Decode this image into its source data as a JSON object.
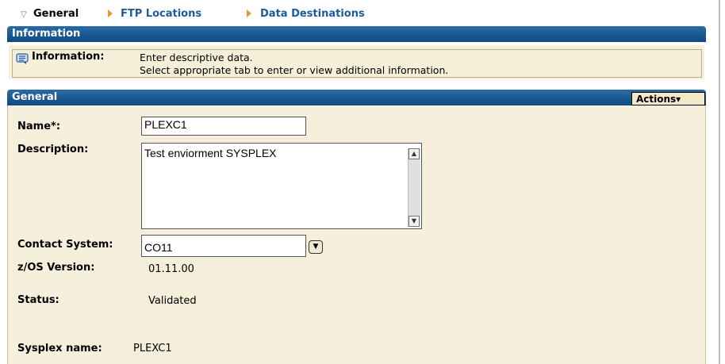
{
  "tabs": {
    "active": "General",
    "links": [
      "FTP Locations",
      "Data Destinations"
    ]
  },
  "info_panel": {
    "title": "Information",
    "label": "Information:",
    "line1": "Enter descriptive data.",
    "line2": "Select appropriate tab to enter or view additional information."
  },
  "general_panel": {
    "title": "General",
    "actions_label": "Actions▾",
    "name_label": "Name*:",
    "name_value": "PLEXC1",
    "description_label": "Description:",
    "description_value": "Test enviorment SYSPLEX",
    "contact_label": "Contact System:",
    "contact_value": "CO11",
    "zos_label": "z/OS Version:",
    "zos_value": "01.11.00",
    "status_label": "Status:",
    "status_value": "Validated",
    "sysplex_label": "Sysplex name:",
    "sysplex_value": "PLEXC1"
  },
  "colors": {
    "header_bar": "#0f4d86",
    "panel_bg": "#f6efdb",
    "tab_link": "#1c5c9c",
    "tab_arrow": "#e89b2c"
  }
}
